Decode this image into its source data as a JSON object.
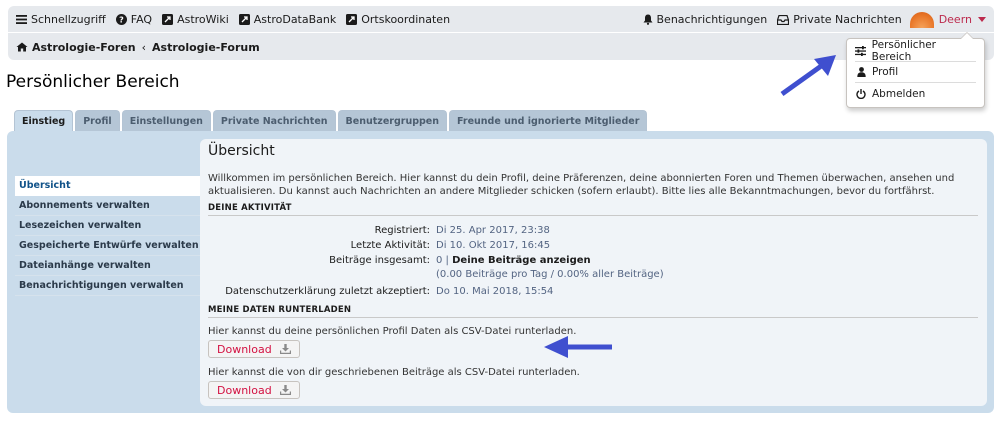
{
  "nav": {
    "links": {
      "quick": "Schnellzugriff",
      "faq": "FAQ",
      "astrowiki": "AstroWiki",
      "astrodatabank": "AstroDataBank",
      "coords": "Ortskoordinaten"
    },
    "notifications": "Benachrichtigungen",
    "messages": "Private Nachrichten",
    "username": "Deern"
  },
  "breadcrumb": {
    "forums": "Astrologie-Foren",
    "forum": "Astrologie-Forum"
  },
  "user_menu": {
    "items": [
      "Persönlicher Bereich",
      "Profil",
      "Abmelden"
    ]
  },
  "page_title": "Persönlicher Bereich",
  "tabs": [
    "Einstieg",
    "Profil",
    "Einstellungen",
    "Private Nachrichten",
    "Benutzergruppen",
    "Freunde und ignorierte Mitglieder"
  ],
  "sidenav": [
    "Übersicht",
    "Abonnements verwalten",
    "Lesezeichen verwalten",
    "Gespeicherte Entwürfe verwalten",
    "Dateianhänge verwalten",
    "Benachrichtigungen verwalten"
  ],
  "main": {
    "title": "Übersicht",
    "intro": "Willkommen im persönlichen Bereich. Hier kannst du dein Profil, deine Präferenzen, deine abonnierten Foren und Themen überwachen, ansehen und aktualisieren. Du kannst auch Nachrichten an andere Mitglieder schicken (sofern erlaubt). Bitte lies alle Bekanntmachungen, bevor du fortfährst.",
    "activity_heading": "DEINE AKTIVITÄT",
    "activity": {
      "registered_label": "Registriert:",
      "registered_value": "Di 25. Apr 2017, 23:38",
      "last_label": "Letzte Aktivität:",
      "last_value": "Di 10. Okt 2017, 16:45",
      "posts_label": "Beiträge insgesamt:",
      "posts_count": "0 |",
      "posts_link": "Deine Beiträge anzeigen",
      "posts_stats": "(0.00 Beiträge pro Tag / 0.00% aller Beiträge)",
      "privacy_label": "Datenschutzerklärung zuletzt akzeptiert:",
      "privacy_value": "Do 10. Mai 2018, 15:54"
    },
    "download_heading": "MEINE DATEN RUNTERLADEN",
    "download_profile_text": "Hier kannst du deine persönlichen Profil Daten als CSV-Datei runterladen.",
    "download_posts_text": "Hier kannst die von dir geschriebenen Beiträge als CSV-Datei runterladen.",
    "download_label": "Download"
  },
  "colors": {
    "accent_red": "#d31141",
    "panel_blue": "#cadceb",
    "annotation_arrow": "#3f4fcf"
  }
}
